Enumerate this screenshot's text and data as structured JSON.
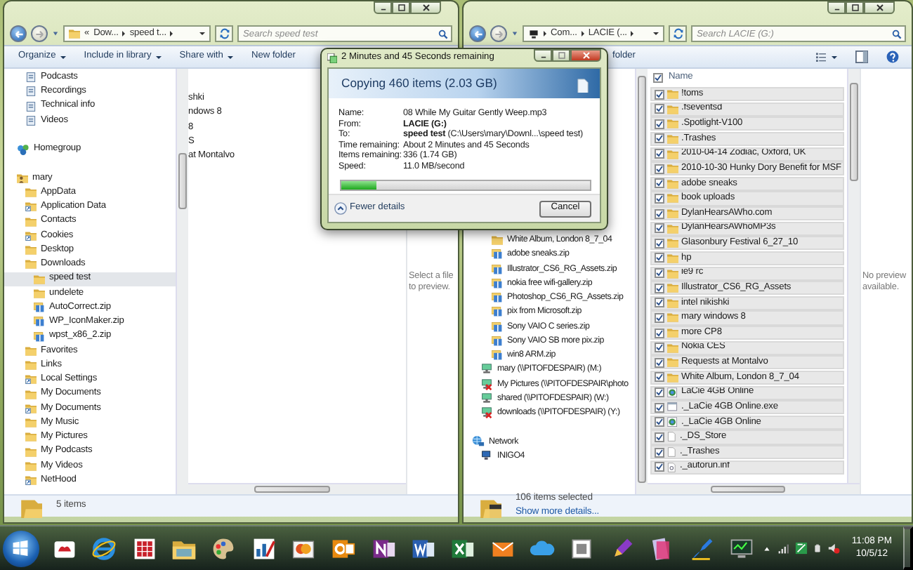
{
  "left_window": {
    "address": {
      "crumbs": [
        "«",
        "Dow...",
        "speed t..."
      ],
      "search_placeholder": "Search speed test"
    },
    "toolbar": [
      {
        "label": "Organize",
        "dropdown": true
      },
      {
        "label": "Include in library",
        "dropdown": true
      },
      {
        "label": "Share with",
        "dropdown": true
      },
      {
        "label": "New folder",
        "dropdown": false
      }
    ],
    "nav_tree": [
      {
        "label": "Podcasts",
        "kind": "library",
        "selected": false
      },
      {
        "label": "Recordings",
        "kind": "library",
        "selected": false
      },
      {
        "label": "Technical info",
        "kind": "library",
        "selected": false
      },
      {
        "label": "Videos",
        "kind": "library",
        "selected": false
      },
      {
        "label": "Homegroup",
        "kind": "homegroup",
        "selected": false
      },
      {
        "label": "mary",
        "kind": "user",
        "selected": false,
        "children": [
          {
            "label": "AppData",
            "kind": "folder",
            "selected": false
          },
          {
            "label": "Application Data",
            "kind": "shortcut",
            "selected": false
          },
          {
            "label": "Contacts",
            "kind": "folder",
            "selected": false
          },
          {
            "label": "Cookies",
            "kind": "shortcut",
            "selected": false
          },
          {
            "label": "Desktop",
            "kind": "folder",
            "selected": false
          },
          {
            "label": "Downloads",
            "kind": "folder",
            "selected": false,
            "children": [
              {
                "label": "speed test",
                "kind": "folder",
                "selected": true
              },
              {
                "label": "undelete",
                "kind": "folder",
                "selected": false
              },
              {
                "label": "AutoCorrect.zip",
                "kind": "zip",
                "selected": false
              },
              {
                "label": "WP_IconMaker.zip",
                "kind": "zip",
                "selected": false
              },
              {
                "label": "wpst_x86_2.zip",
                "kind": "zip",
                "selected": false
              }
            ]
          },
          {
            "label": "Favorites",
            "kind": "folder",
            "selected": false
          },
          {
            "label": "Links",
            "kind": "folder",
            "selected": false
          },
          {
            "label": "Local Settings",
            "kind": "shortcut",
            "selected": false
          },
          {
            "label": "My Documents",
            "kind": "folder",
            "selected": false
          },
          {
            "label": "My Documents",
            "kind": "shortcut",
            "selected": false
          },
          {
            "label": "My Music",
            "kind": "folder",
            "selected": false
          },
          {
            "label": "My Pictures",
            "kind": "folder",
            "selected": false
          },
          {
            "label": "My Podcasts",
            "kind": "folder",
            "selected": false
          },
          {
            "label": "My Videos",
            "kind": "folder",
            "selected": false
          },
          {
            "label": "NetHood",
            "kind": "shortcut",
            "selected": false
          }
        ]
      }
    ],
    "content_items": [
      "shki",
      "ndows 8",
      "8",
      "S",
      "at Montalvo"
    ],
    "preview_text": "Select a file to preview.",
    "status": {
      "text": "5 items"
    }
  },
  "right_window": {
    "address": {
      "crumbs": [
        "Com...",
        "LACIE (..."
      ],
      "search_placeholder": "Search LACIE (G:)"
    },
    "toolbar": [
      {
        "label": "folder",
        "dropdown": false
      }
    ],
    "nav_tree": [
      {
        "label": "White Album, London 8_7_04",
        "kind": "folder",
        "selected": false
      },
      {
        "label": "adobe sneaks.zip",
        "kind": "zip",
        "selected": false
      },
      {
        "label": "Illustrator_CS6_RG_Assets.zip",
        "kind": "zip",
        "selected": false
      },
      {
        "label": "nokia free wifi-gallery.zip",
        "kind": "zip",
        "selected": false
      },
      {
        "label": "Photoshop_CS6_RG_Assets.zip",
        "kind": "zip",
        "selected": false
      },
      {
        "label": "pix from Microsoft.zip",
        "kind": "zip",
        "selected": false
      },
      {
        "label": "Sony VAIO C series.zip",
        "kind": "zip",
        "selected": false
      },
      {
        "label": "Sony VAIO SB more pix.zip",
        "kind": "zip",
        "selected": false
      },
      {
        "label": "win8 ARM.zip",
        "kind": "zip",
        "selected": false
      },
      {
        "label": "mary (\\\\PITOFDESPAIR) (M:)",
        "kind": "drive",
        "connected": true,
        "selected": false
      },
      {
        "label": "My Pictures (\\\\PITOFDESPAIR\\photo",
        "kind": "drive",
        "connected": false,
        "selected": false
      },
      {
        "label": "shared (\\\\PITOFDESPAIR) (W:)",
        "kind": "drive",
        "connected": true,
        "selected": false
      },
      {
        "label": "downloads (\\\\PITOFDESPAIR) (Y:)",
        "kind": "drive",
        "connected": false,
        "selected": false
      },
      {
        "label": "Network",
        "kind": "network",
        "selected": false,
        "children": [
          {
            "label": "INIGO4",
            "kind": "computer",
            "selected": false
          }
        ]
      }
    ],
    "header": {
      "label": "Name",
      "checked": true
    },
    "rows": [
      {
        "name": "!toms",
        "kind": "folder",
        "checked": true
      },
      {
        "name": ".fseventsd",
        "kind": "folder",
        "checked": true
      },
      {
        "name": ".Spotlight-V100",
        "kind": "folder",
        "checked": true
      },
      {
        "name": ".Trashes",
        "kind": "folder",
        "checked": true
      },
      {
        "name": "2010-04-14 Zodiac, Oxford, UK",
        "kind": "folder",
        "checked": true
      },
      {
        "name": "2010-10-30 Hunky Dory Benefit for MSF",
        "kind": "folder",
        "checked": true
      },
      {
        "name": "adobe sneaks",
        "kind": "folder",
        "checked": true
      },
      {
        "name": "book uploads",
        "kind": "folder",
        "checked": true
      },
      {
        "name": "DylanHearsAWho.com",
        "kind": "folder",
        "checked": true
      },
      {
        "name": "DylanHearsAWhoMP3s",
        "kind": "folder",
        "checked": true
      },
      {
        "name": "Glasonbury Festival 6_27_10",
        "kind": "folder",
        "checked": true
      },
      {
        "name": "hp",
        "kind": "folder",
        "checked": true
      },
      {
        "name": "ie9 rc",
        "kind": "folder",
        "checked": true
      },
      {
        "name": "Illustrator_CS6_RG_Assets",
        "kind": "folder",
        "checked": true
      },
      {
        "name": "intel nikishki",
        "kind": "folder",
        "checked": true
      },
      {
        "name": "mary windows 8",
        "kind": "folder",
        "checked": true
      },
      {
        "name": "more CP8",
        "kind": "folder",
        "checked": true
      },
      {
        "name": "Nokia CES",
        "kind": "folder",
        "checked": true
      },
      {
        "name": "Requests at Montalvo",
        "kind": "folder",
        "checked": true
      },
      {
        "name": "White Album, London 8_7_04",
        "kind": "folder",
        "checked": true
      },
      {
        "name": "LaCie 4GB Online",
        "kind": "app",
        "checked": true
      },
      {
        "name": "._LaCie 4GB Online.exe",
        "kind": "exe",
        "checked": true
      },
      {
        "name": "._LaCie 4GB Online",
        "kind": "app",
        "checked": true
      },
      {
        "name": "._DS_Store",
        "kind": "file",
        "checked": true
      },
      {
        "name": "._Trashes",
        "kind": "file",
        "checked": true
      },
      {
        "name": "._autorun.inf",
        "kind": "settings",
        "checked": true
      }
    ],
    "preview_text": "No preview available.",
    "status": {
      "text": "106 items selected",
      "link": "Show more details..."
    }
  },
  "copy_dialog": {
    "title": "2 Minutes and 45 Seconds remaining",
    "heading": "Copying 460 items (2.03 GB)",
    "details": [
      {
        "label": "Name:",
        "value": "08 While My Guitar Gently Weep.mp3",
        "bold": false
      },
      {
        "label": "From:",
        "value": "LACIE (G:)",
        "bold": true
      },
      {
        "label": "To:",
        "value": "**speed test** (C:\\Users\\mary\\Downl...\\speed test)",
        "bold": false
      },
      {
        "label": "Time remaining:",
        "value": "About 2 Minutes and 45 Seconds",
        "bold": false
      },
      {
        "label": "Items remaining:",
        "value": "336 (1.74 GB)",
        "bold": false
      },
      {
        "label": "Speed:",
        "value": "11.0 MB/second",
        "bold": false
      }
    ],
    "progress": {
      "level": 0.14
    },
    "toggle": {
      "label": "Fewer details",
      "expanded": true
    },
    "cancel": "Cancel"
  },
  "taskbar": {
    "time": "11:08 PM",
    "date": "10/5/12"
  }
}
